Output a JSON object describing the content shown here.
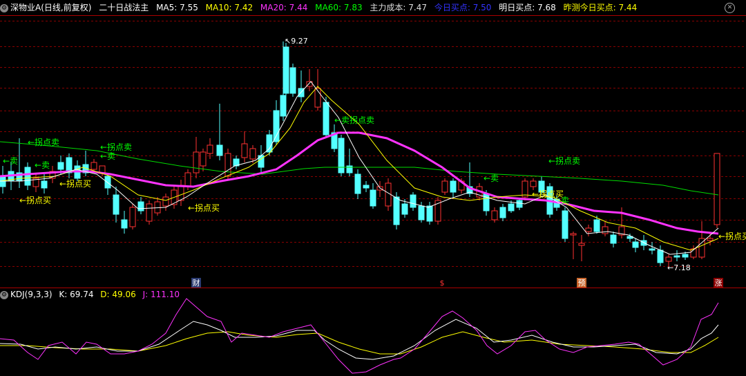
{
  "header": {
    "stock": "深物业A(日线,前复权)",
    "indicator_name": "二十日战法主",
    "ma5": {
      "label": "MA5: ",
      "value": "7.55",
      "color": "#ffffff"
    },
    "ma10": {
      "label": "MA10: ",
      "value": "7.42",
      "color": "#ffff00"
    },
    "ma20": {
      "label": "MA20: ",
      "value": "7.44",
      "color": "#ff33ff"
    },
    "ma60": {
      "label": "MA60: ",
      "value": "7.83",
      "color": "#00ff00"
    },
    "cost": {
      "label": "主力成本: ",
      "value": "7.47",
      "color": "#dddddd"
    },
    "today_buy": {
      "label": "今日买点: ",
      "value": "7.50",
      "color": "#3333ff"
    },
    "tomorrow_buy": {
      "label": "明日买点: ",
      "value": "7.68",
      "color": "#ffffff"
    },
    "predict_buy": {
      "label": "昨测今日买点: ",
      "value": "7.44",
      "color": "#ffff00"
    }
  },
  "kdj_header": {
    "name": "KDJ(9,3,3)",
    "k": {
      "label": "K: ",
      "value": "69.74",
      "color": "#ffffff"
    },
    "d": {
      "label": "D: ",
      "value": "49.06",
      "color": "#ffff00"
    },
    "j": {
      "label": "J: ",
      "value": "111.10",
      "color": "#ff33ff"
    }
  },
  "colors": {
    "up": "#ff3232",
    "down": "#54ffff",
    "grid": "#8b0000",
    "ma5": "#ffffff",
    "ma10": "#ffff00",
    "ma20": "#ff33ff",
    "ma60": "#00dd00"
  },
  "chart_data": [
    {
      "type": "candlestick",
      "series": [
        {
          "name": "MA5",
          "color": "#ffffff"
        },
        {
          "name": "MA10",
          "color": "#ffff00"
        },
        {
          "name": "MA20",
          "color": "#ff33ff"
        },
        {
          "name": "MA60",
          "color": "#00dd00"
        }
      ],
      "high_mark": {
        "text": "9.27",
        "value": 9.27
      },
      "low_mark": {
        "text": "7.18",
        "value": 7.18
      },
      "annotations": [
        {
          "text": "←拐点卖",
          "color": "#00ff00"
        },
        {
          "text": "←卖",
          "color": "#00ff00"
        },
        {
          "text": "←卖",
          "color": "#00ff00"
        },
        {
          "text": "←拐点卖",
          "color": "#00ff00"
        },
        {
          "text": "←卖",
          "color": "#00ff00"
        },
        {
          "text": "←拐点买",
          "color": "#ffff00"
        },
        {
          "text": "←拐点买",
          "color": "#ffff00"
        },
        {
          "text": "←拐点买",
          "color": "#ffff00"
        },
        {
          "text": "←卖拐点卖",
          "color": "#00ff00"
        },
        {
          "text": "←卖",
          "color": "#00ff00"
        },
        {
          "text": "←拐点卖",
          "color": "#00ff00"
        },
        {
          "text": "←拐点买",
          "color": "#ffff00"
        },
        {
          "text": "卖",
          "color": "#00ff00"
        },
        {
          "text": "←拐点买",
          "color": "#ffff00"
        }
      ],
      "markers": [
        {
          "text": "财",
          "bg": "#2a3a70",
          "color": "#ffffff"
        },
        {
          "text": "$",
          "bg": "#000000",
          "color": "#ff3232"
        },
        {
          "text": "预",
          "bg": "#c8642a",
          "color": "#ffffff"
        },
        {
          "text": "涨",
          "bg": "#8b0000",
          "color": "#ffffff"
        }
      ]
    },
    {
      "type": "line",
      "series": [
        {
          "name": "K",
          "color": "#ffffff"
        },
        {
          "name": "D",
          "color": "#ffff00"
        },
        {
          "name": "J",
          "color": "#ff33ff"
        }
      ],
      "last": {
        "K": 69.74,
        "D": 49.06,
        "J": 111.1
      }
    }
  ]
}
